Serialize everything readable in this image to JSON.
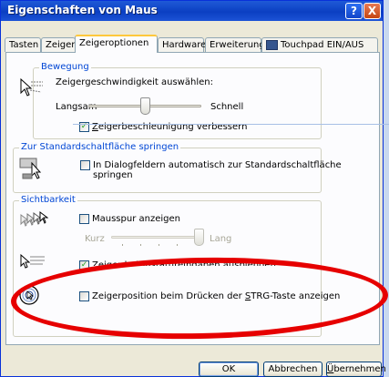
{
  "window": {
    "title": "Eigenschaften von Maus",
    "help_label": "?",
    "close_label": "X"
  },
  "tabs": [
    {
      "label": "Tasten"
    },
    {
      "label": "Zeiger"
    },
    {
      "label": "Zeigeroptionen"
    },
    {
      "label": "Hardware"
    },
    {
      "label": "Erweiterung"
    },
    {
      "label": "Touchpad EIN/AUS"
    }
  ],
  "motion": {
    "title": "Bewegung",
    "speed_label": "Zeigergeschwindigkeit auswählen:",
    "slow_label": "Langsam",
    "fast_label": "Schnell",
    "speed_level": 0.5,
    "accel_label": "Zeigerbeschleunigung verbessern",
    "accel_checked": true
  },
  "snap": {
    "title": "Zur Standardschaltfläche springen",
    "label_line1": "In Dialogfeldern automatisch zur Standardschaltfläche",
    "label_line2": "springen",
    "checked": false
  },
  "visibility": {
    "title": "Sichtbarkeit",
    "trails_label": "Mausspur anzeigen",
    "trails_checked": false,
    "short_label": "Kurz",
    "long_label": "Lang",
    "trails_level": 1.0,
    "hide_label": "Zeiger bei Tastatureingaben ausblenden",
    "hide_checked": true,
    "ctrl_label": "Zeigerposition beim Drücken der STRG-Taste anzeigen",
    "ctrl_checked": false
  },
  "buttons": {
    "ok": "OK",
    "cancel": "Abbrechen",
    "apply": "Übernehmen"
  },
  "colors": {
    "title_bar": "#0b3fc2",
    "group_title": "#0046d5",
    "highlight_ring": "#e60000"
  }
}
